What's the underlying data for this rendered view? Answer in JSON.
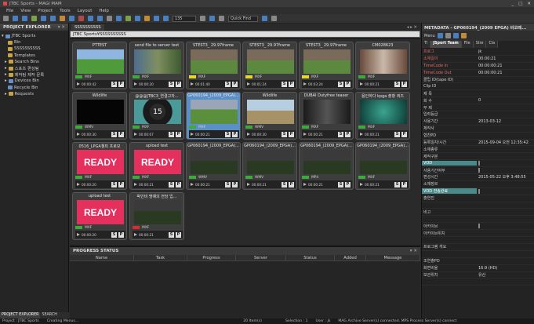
{
  "titlebar": {
    "title": "JTBC Sports - MAGI MAM",
    "min": "_",
    "max": "□",
    "close": "✕"
  },
  "menu": [
    "File",
    "View",
    "Project",
    "Tools",
    "Layout",
    "Help"
  ],
  "toolbar": {
    "zoom_value": "135",
    "quick_find_label": "Quick Find"
  },
  "explorer": {
    "title": "PROJECT EXPLORER",
    "tree": [
      {
        "label": "JTBC Sports",
        "indent": 0,
        "type": "root"
      },
      {
        "label": "Bin",
        "indent": 1,
        "type": "folder"
      },
      {
        "label": "SSSSSSSSSS",
        "indent": 1,
        "type": "folder"
      },
      {
        "label": "Templates",
        "indent": 1,
        "type": "folder"
      },
      {
        "label": "Search Bins",
        "indent": 1,
        "type": "folder"
      },
      {
        "label": "스포츠 편성팀",
        "indent": 1,
        "type": "folder"
      },
      {
        "label": "제작팀 제작 문록",
        "indent": 1,
        "type": "folder"
      },
      {
        "label": "Devices Bin",
        "indent": 1,
        "type": "folder"
      },
      {
        "label": "Recycle Bin",
        "indent": 1,
        "type": "folder"
      },
      {
        "label": "Requests",
        "indent": 1,
        "type": "folder"
      }
    ],
    "tabs": [
      "PROJECT EXPLORER",
      "SEARCH"
    ]
  },
  "document": {
    "tab_label": "SSSSSSSSSS",
    "path": "JTBC Sports¥SSSSSSSSSS"
  },
  "clips": [
    {
      "title": "PTTEST",
      "format": "MXF",
      "time": "00:00:42",
      "bar": "#3fa83f",
      "thumb": "field",
      "selected": false
    },
    {
      "title": "send file  to server test",
      "format": "MXF",
      "time": "00:00:20",
      "bar": "#3fa83f",
      "thumb": "golfers",
      "selected": false
    },
    {
      "title": "STEST3_ 29.97frame",
      "format": "MXF",
      "time": "00:01:40",
      "bar": "#e8d62a",
      "thumb": "crowd",
      "selected": false
    },
    {
      "title": "STEST3_ 29.97frame",
      "format": "MXF",
      "time": "00:01:24",
      "bar": "#e8d62a",
      "thumb": "crowd",
      "selected": false
    },
    {
      "title": "STEST3_ 29.97frame",
      "format": "MXF",
      "time": "00:03:24",
      "bar": "#e8d62a",
      "thumb": "crowd",
      "selected": false
    },
    {
      "title": "CM028623",
      "format": "MXF",
      "time": "00:00:21",
      "bar": "#3fa83f",
      "thumb": "bottles",
      "selected": false
    },
    {
      "title": "Wildlife",
      "format": "WMV",
      "time": "00:00:30",
      "bar": "#3fa83f",
      "thumb": "black",
      "selected": false
    },
    {
      "title": "@@@JTBC3_연결고자...",
      "format": "MXF",
      "time": "00:00:07",
      "bar": "#3fa83f",
      "thumb": "countdown",
      "selected": false
    },
    {
      "title": "GP060194_(2009_EPGA)...",
      "format": "MXF",
      "time": "00:00:21",
      "bar": "#3fa83f",
      "thumb": "field2",
      "selected": true
    },
    {
      "title": "Wildlife",
      "format": "WMV",
      "time": "00:00:30",
      "bar": "#3fa83f",
      "thumb": "savanna",
      "selected": false
    },
    {
      "title": "DUBAI Dutyfree teaser",
      "format": "MXF",
      "time": "00:00:21",
      "bar": "#3fa83f",
      "thumb": "dark",
      "selected": false
    },
    {
      "title": "용인하다 kpga 출항 퀴즈",
      "format": "MXF",
      "time": "00:00:21",
      "bar": "#3fa83f",
      "thumb": "teal",
      "selected": false
    },
    {
      "title": "0516_LPGA챔피 프로모",
      "format": "MXF",
      "time": "00:00:20",
      "bar": "#3fa83f",
      "thumb": "ready",
      "selected": false
    },
    {
      "title": "upload test",
      "format": "MXF",
      "time": "00:00:21",
      "bar": "#3fa83f",
      "thumb": "ready",
      "selected": false
    },
    {
      "title": "GP060194_(2009_EPGA)...",
      "format": "WMV",
      "time": "00:00:21",
      "bar": "#3fa83f",
      "thumb": "darkfield",
      "selected": false
    },
    {
      "title": "GP060194_(2009_EPGA)...",
      "format": "WMV",
      "time": "00:00:21",
      "bar": "#3fa83f",
      "thumb": "darkfield",
      "selected": false
    },
    {
      "title": "GP060194_(2009_EPGA)...",
      "format": "MP4",
      "time": "00:00:21",
      "bar": "#3fa83f",
      "thumb": "darkfield",
      "selected": false
    },
    {
      "title": "GP060194_(2009_EPGA)...",
      "format": "MXF",
      "time": "00:00:21",
      "bar": "#3fa83f",
      "thumb": "darkfield",
      "selected": false
    },
    {
      "title": "upload test",
      "format": "MXF",
      "time": "00:00:20",
      "bar": "#3fa83f",
      "thumb": "ready",
      "selected": false
    },
    {
      "title": "박인비 명예의 전당 입...",
      "format": "MXF",
      "time": "00:00:21",
      "bar": "#d03030",
      "thumb": "darkfield",
      "selected": false
    }
  ],
  "progress": {
    "title": "PROGRESS STATUS",
    "columns": [
      "Name",
      "Task",
      "Progress",
      "Server",
      "Status",
      "Added",
      "Message"
    ]
  },
  "metadata": {
    "title": "METADATA - GP060194_(2009 EPGA) 바코레...",
    "menu_label": "Menu",
    "tabs": [
      "Tl",
      "JSport Team",
      "File",
      "Stre",
      "Cla"
    ],
    "rows": [
      {
        "k": "프로그",
        "v": "jk",
        "red": true
      },
      {
        "k": "소재길이",
        "v": "00:00:21",
        "red": true
      },
      {
        "k": "TimeCode In",
        "v": "00:00:00:21",
        "red": true
      },
      {
        "k": "TimeCode Out",
        "v": "00:00:00:21",
        "red": true
      },
      {
        "k": "클립 ID(tape ID)",
        "v": ""
      },
      {
        "k": "Clip ID",
        "v": ""
      },
      {
        "k": "제 목",
        "v": ""
      },
      {
        "k": "회 수",
        "v": "0"
      },
      {
        "k": "부 제",
        "v": ""
      },
      {
        "k": "입력등급",
        "v": ""
      },
      {
        "k": "사용기간",
        "v": "2013-03-12"
      },
      {
        "k": "제작사",
        "v": ""
      },
      {
        "k": "협찬PD",
        "v": ""
      },
      {
        "k": "등록일자/시간",
        "v": "2015-09-04 오전 12:35:42"
      },
      {
        "k": "소재종류",
        "v": ""
      },
      {
        "k": "제작구분",
        "v": ""
      },
      {
        "k": "VOD",
        "v": "",
        "cb": true,
        "hl": true
      },
      {
        "k": "사용기간여부",
        "v": "",
        "cb": true
      },
      {
        "k": "편성시간",
        "v": "2015-05-22 오후 3:48:55"
      },
      {
        "k": "소재장르",
        "v": ""
      },
      {
        "k": "VOD 전송완료",
        "v": "",
        "cb": true,
        "hl": true
      },
      {
        "k": "출연진",
        "v": ""
      },
      {
        "k": "",
        "v": ""
      },
      {
        "k": "비고",
        "v": ""
      },
      {
        "k": "",
        "v": ""
      },
      {
        "k": "아카이브",
        "v": "",
        "cb": true
      },
      {
        "k": "아카이브위치",
        "v": ""
      },
      {
        "k": "",
        "v": ""
      },
      {
        "k": "프로그램 개요",
        "v": ""
      },
      {
        "k": "",
        "v": ""
      },
      {
        "k": "조연출PD",
        "v": ""
      },
      {
        "k": "화면비율",
        "v": "16:9 (HD)"
      },
      {
        "k": "보관위치",
        "v": "유산"
      },
      {
        "k": "",
        "v": ""
      }
    ]
  },
  "status": {
    "project": "Project : JTBC Sports",
    "state": "Creating Menus...",
    "items": "20 Item(s)",
    "selection": "Selection : 1",
    "user": "User : jk",
    "message": "MAG Archive Server(s) connected.  MPS Process Server(s) connect"
  }
}
